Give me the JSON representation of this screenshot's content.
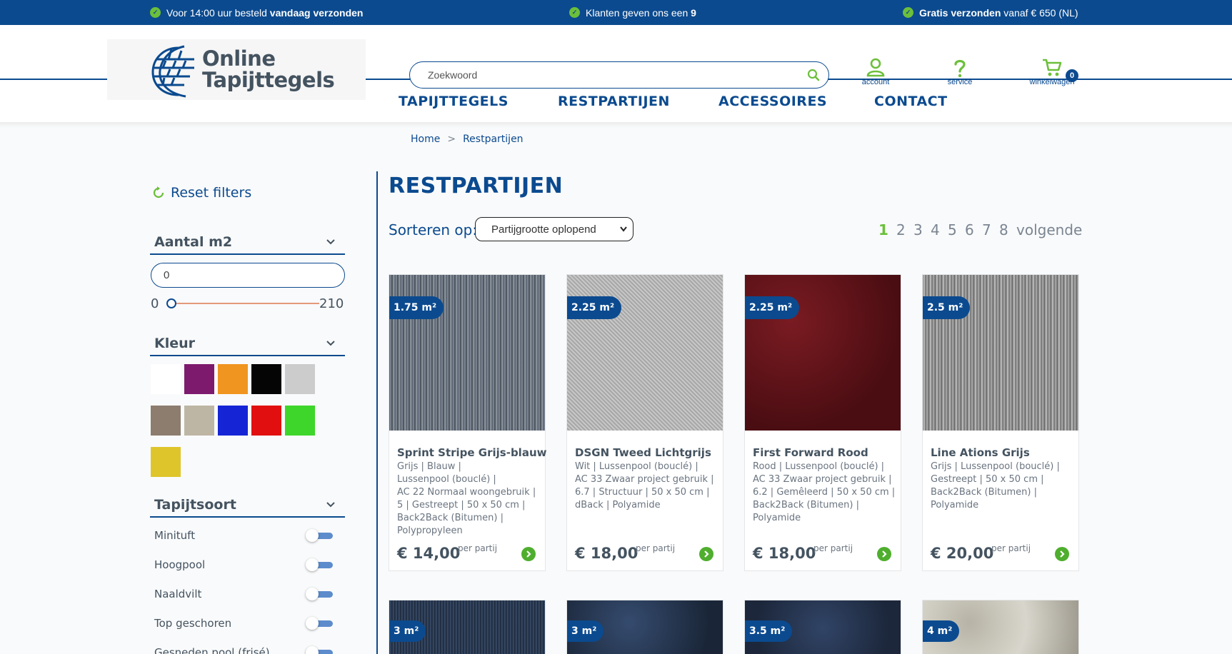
{
  "topbar": {
    "usp1_pre": "Voor 14:00 uur besteld ",
    "usp1_bold": "vandaag verzonden",
    "usp2_pre": "Klanten geven ons een ",
    "usp2_bold": "9",
    "usp3_bold": "Gratis verzonden",
    "usp3_post": " vanaf € 650 (NL)"
  },
  "logo": {
    "line1": "Online",
    "line2": "Tapijttegels"
  },
  "search": {
    "placeholder": "Zoekwoord"
  },
  "header_icons": {
    "account": "account",
    "service": "service",
    "cart": "winkelwagen",
    "cart_count": "0"
  },
  "nav": [
    "TAPIJTTEGELS",
    "RESTPARTIJEN",
    "ACCESSOIRES",
    "CONTACT"
  ],
  "breadcrumb": {
    "home": "Home",
    "sep": ">",
    "current": "Restpartijen"
  },
  "sidebar": {
    "reset": "Reset filters",
    "m2_heading": "Aantal m2",
    "m2_value": "0",
    "range_min": "0",
    "range_max": "210",
    "range_position": 0,
    "color_heading": "Kleur",
    "colors": [
      "#ffffff",
      "#7d1a6e",
      "#f0951f",
      "#050505",
      "#cccccc",
      "#8c7d6e",
      "#bdb6a4",
      "#1525d6",
      "#e10f0f",
      "#3ed62b",
      "#dfc52c"
    ],
    "tapijtsoort_heading": "Tapijtsoort",
    "tapijtsoort": [
      "Minituft",
      "Hoogpool",
      "Naaldvilt",
      "Top geschoren",
      "Gesneden pool (frisé)"
    ]
  },
  "main": {
    "title": "RESTPARTIJEN",
    "sort_label": "Sorteren op:",
    "sort_value": "Partijgrootte oplopend",
    "pages": [
      "1",
      "2",
      "3",
      "4",
      "5",
      "6",
      "7",
      "8"
    ],
    "next": "volgende",
    "current_page": "1"
  },
  "products": [
    {
      "badge": "1.75 m²",
      "name": "Sprint Stripe Grijs-blauw",
      "specs": [
        "Grijs | Blauw |",
        "Lussenpool (bouclé) |",
        "AC 22 Normaal woongebruik |",
        "5 | Gestreept | 50 x 50 cm |",
        "Back2Back (Bitumen) |",
        "Polypropyleen"
      ],
      "price": "€ 14,00",
      "unit": "per partij",
      "texture": "stripe-gray"
    },
    {
      "badge": "2.25 m²",
      "name": "DSGN Tweed Lichtgrijs",
      "specs": [
        "Wit | Lussenpool (bouclé) |",
        "AC 33 Zwaar project gebruik |",
        "6.7 | Structuur | 50 x 50 cm |",
        "dBack | Polyamide"
      ],
      "price": "€ 18,00",
      "unit": "per partij",
      "texture": "tweed"
    },
    {
      "badge": "2.25 m²",
      "name": "First Forward Rood",
      "specs": [
        "Rood | Lussenpool (bouclé) |",
        "AC 33 Zwaar project gebruik |",
        "6.2 | Gemêleerd | 50 x 50 cm |",
        "Back2Back (Bitumen) |",
        "Polyamide"
      ],
      "price": "€ 18,00",
      "unit": "per partij",
      "texture": "red"
    },
    {
      "badge": "2.5 m²",
      "name": "Line Ations Grijs",
      "specs": [
        "Grijs | Lussenpool (bouclé) |",
        "Gestreept | 50 x 50 cm |",
        "Back2Back (Bitumen) |",
        "Polyamide"
      ],
      "price": "€ 20,00",
      "unit": "per partij",
      "texture": "lines-gray"
    }
  ],
  "products_row2": [
    {
      "badge": "3 m²",
      "texture": "dark-blue"
    },
    {
      "badge": "3 m²",
      "texture": "navy"
    },
    {
      "badge": "3.5 m²",
      "texture": "blue-melange"
    },
    {
      "badge": "4 m²",
      "texture": "beige"
    }
  ]
}
